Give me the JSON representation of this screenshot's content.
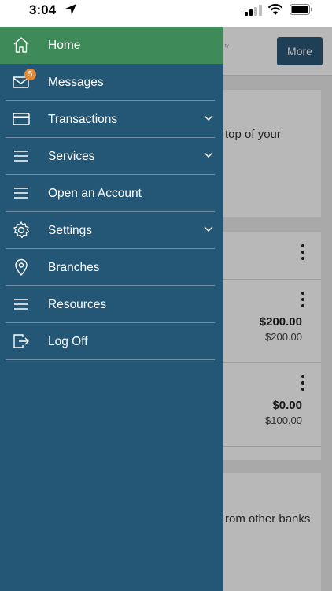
{
  "status_bar": {
    "time": "3:04"
  },
  "background": {
    "more_button": "More",
    "card1_text": "top of your",
    "account1": {
      "balance": "$200.00",
      "available": "$200.00"
    },
    "account2": {
      "balance": "$0.00",
      "available": "$100.00"
    },
    "card3_text": "rom other banks"
  },
  "menu": {
    "items": [
      {
        "label": "Home",
        "icon": "home-icon",
        "active": true
      },
      {
        "label": "Messages",
        "icon": "mail-icon",
        "badge": "5"
      },
      {
        "label": "Transactions",
        "icon": "card-icon",
        "expandable": true
      },
      {
        "label": "Services",
        "icon": "list-icon",
        "expandable": true
      },
      {
        "label": "Open an Account",
        "icon": "list-icon"
      },
      {
        "label": "Settings",
        "icon": "gear-icon",
        "expandable": true
      },
      {
        "label": "Branches",
        "icon": "location-pin-icon"
      },
      {
        "label": "Resources",
        "icon": "list-icon"
      },
      {
        "label": "Log Off",
        "icon": "logout-icon"
      }
    ]
  },
  "colors": {
    "drawer": "#245675",
    "active": "#3e8a58",
    "badge": "#e28a36"
  }
}
